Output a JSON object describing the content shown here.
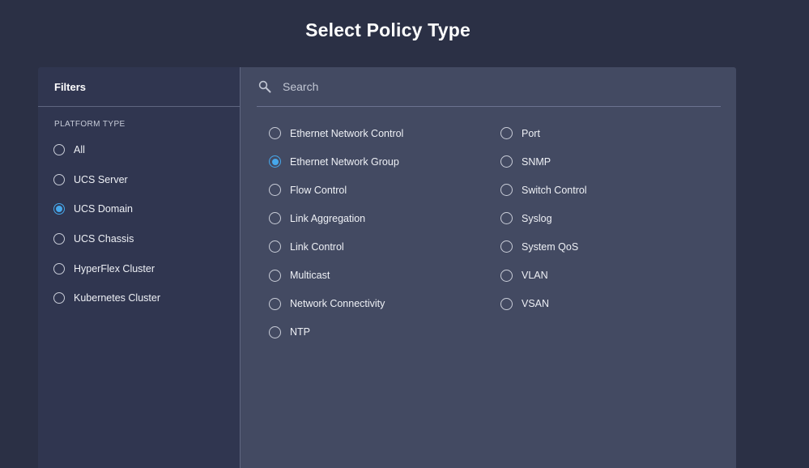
{
  "page": {
    "title": "Select Policy Type"
  },
  "filters": {
    "header": "Filters",
    "section_label": "PLATFORM TYPE",
    "options": [
      {
        "label": "All",
        "selected": false
      },
      {
        "label": "UCS Server",
        "selected": false
      },
      {
        "label": "UCS Domain",
        "selected": true
      },
      {
        "label": "UCS Chassis",
        "selected": false
      },
      {
        "label": "HyperFlex Cluster",
        "selected": false
      },
      {
        "label": "Kubernetes Cluster",
        "selected": false
      }
    ]
  },
  "search": {
    "placeholder": "Search",
    "value": ""
  },
  "policies": {
    "left": [
      {
        "label": "Ethernet Network Control",
        "selected": false
      },
      {
        "label": "Ethernet Network Group",
        "selected": true
      },
      {
        "label": "Flow Control",
        "selected": false
      },
      {
        "label": "Link Aggregation",
        "selected": false
      },
      {
        "label": "Link Control",
        "selected": false
      },
      {
        "label": "Multicast",
        "selected": false
      },
      {
        "label": "Network Connectivity",
        "selected": false
      },
      {
        "label": "NTP",
        "selected": false
      }
    ],
    "right": [
      {
        "label": "Port",
        "selected": false
      },
      {
        "label": "SNMP",
        "selected": false
      },
      {
        "label": "Switch Control",
        "selected": false
      },
      {
        "label": "Syslog",
        "selected": false
      },
      {
        "label": "System QoS",
        "selected": false
      },
      {
        "label": "VLAN",
        "selected": false
      },
      {
        "label": "VSAN",
        "selected": false
      }
    ]
  },
  "colors": {
    "background": "#2b3045",
    "filters_bg": "#303650",
    "content_bg": "#434a62",
    "accent": "#46a8ec"
  },
  "icons": {
    "search": "search-icon"
  }
}
